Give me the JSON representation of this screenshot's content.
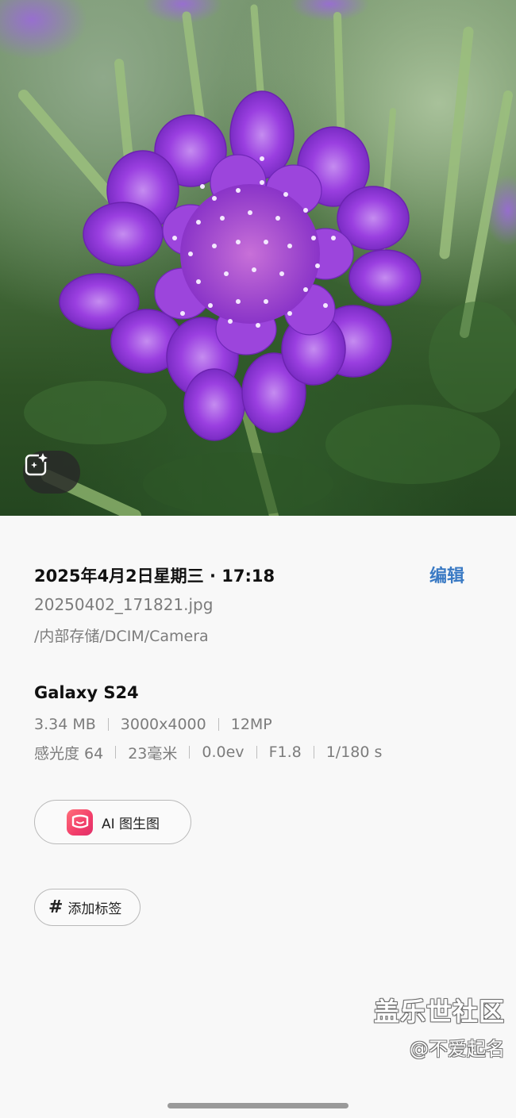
{
  "photo": {
    "subject": "purple scabiosa flower",
    "ai_button_icon": "sparkle-edit-icon"
  },
  "details": {
    "datetime": "2025年4月2日星期三 · 17:18",
    "edit_label": "编辑",
    "filename": "20250402_171821.jpg",
    "path": "/内部存储/DCIM/Camera"
  },
  "device": {
    "model": "Galaxy S24",
    "row1": [
      "3.34 MB",
      "3000x4000",
      "12MP"
    ],
    "row2": [
      "感光度 64",
      "23毫米",
      "0.0ev",
      "F1.8",
      "1/180 s"
    ]
  },
  "actions": {
    "ai_label": "AI 图生图",
    "ai_icon": "meitu-app-icon",
    "tag_label": "添加标签",
    "tag_icon": "hash-icon"
  },
  "watermark": {
    "site": "盖乐世社区",
    "user": "@不爱起名"
  },
  "colors": {
    "accent": "#3a7ac4",
    "secondary_text": "#7c7c7c"
  }
}
